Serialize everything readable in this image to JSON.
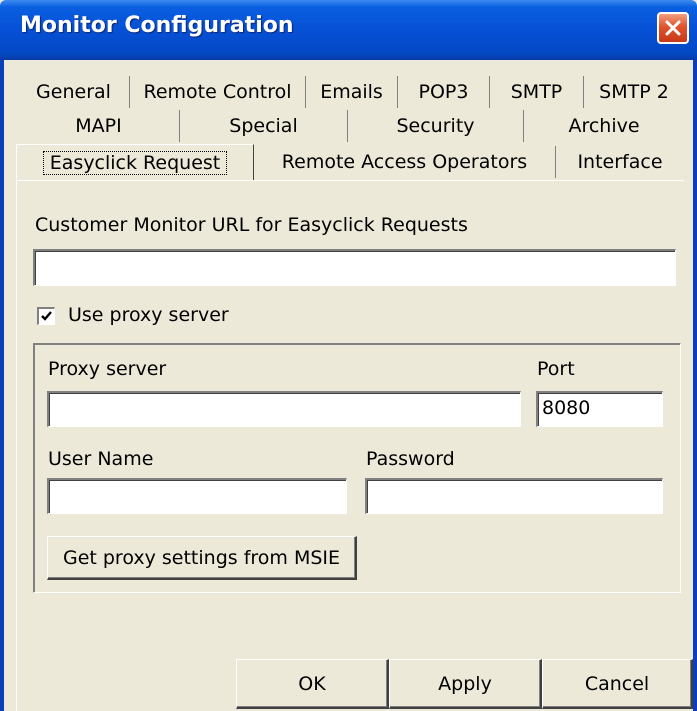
{
  "window": {
    "title": "Monitor Configuration"
  },
  "tabs": {
    "row1": [
      "General",
      "Remote Control",
      "Emails",
      "POP3",
      "SMTP",
      "SMTP 2"
    ],
    "row2": [
      "MAPI",
      "Special",
      "Security",
      "Archive"
    ],
    "row3": [
      "Easyclick Request",
      "Remote Access Operators",
      "Interface"
    ],
    "active": "Easyclick Request"
  },
  "form": {
    "url_label": "Customer Monitor URL for Easyclick Requests",
    "url_value": "",
    "use_proxy_label": "Use proxy server",
    "use_proxy_checked": true,
    "proxy_server_label": "Proxy server",
    "proxy_server_value": "",
    "port_label": "Port",
    "port_value": "8080",
    "username_label": "User Name",
    "username_value": "",
    "password_label": "Password",
    "password_value": "",
    "get_proxy_button": "Get proxy settings from MSIE"
  },
  "buttons": {
    "ok": "OK",
    "apply": "Apply",
    "cancel": "Cancel"
  },
  "colors": {
    "titlebar": "#0650d6",
    "close": "#e0542a",
    "face": "#ece9d8"
  },
  "icons": {
    "close": "close-icon",
    "check": "checkmark-icon"
  }
}
